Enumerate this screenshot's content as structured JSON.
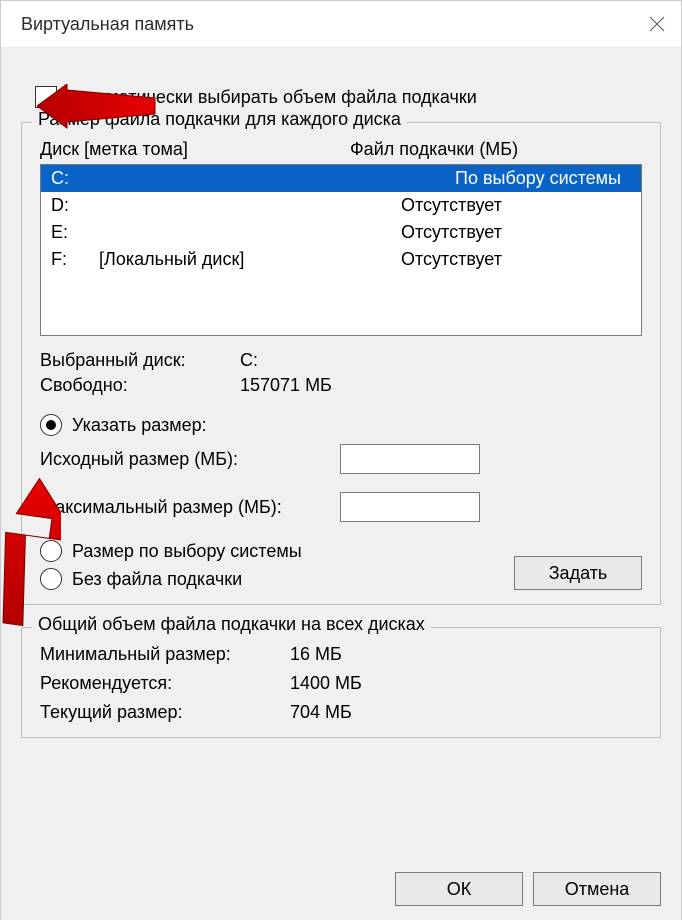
{
  "title": "Виртуальная память",
  "auto_label": "Автоматически выбирать объем файла подкачки",
  "group1": {
    "legend": "Размер файла подкачки для каждого диска",
    "col_drive": "Диск [метка тома]",
    "col_pf": "Файл подкачки (МБ)",
    "rows": [
      {
        "drive": "C:",
        "label": "",
        "status": "По выбору системы",
        "selected": true
      },
      {
        "drive": "D:",
        "label": "",
        "status": "Отсутствует",
        "selected": false
      },
      {
        "drive": "E:",
        "label": "",
        "status": "Отсутствует",
        "selected": false
      },
      {
        "drive": "F:",
        "label": "[Локальный диск]",
        "status": "Отсутствует",
        "selected": false
      }
    ],
    "selected_drive_label": "Выбранный диск:",
    "selected_drive_value": "C:",
    "free_label": "Свободно:",
    "free_value": "157071 МБ",
    "radio_custom": "Указать размер:",
    "initial_label": "Исходный размер (МБ):",
    "initial_value": "",
    "max_label": "Максимальный размер (МБ):",
    "max_value": "",
    "radio_system": "Размер по выбору системы",
    "radio_none": "Без файла подкачки",
    "set_btn": "Задать"
  },
  "group2": {
    "legend": "Общий объем файла подкачки на всех дисках",
    "min_label": "Минимальный размер:",
    "min_value": "16 МБ",
    "rec_label": "Рекомендуется:",
    "rec_value": "1400 МБ",
    "cur_label": "Текущий размер:",
    "cur_value": "704 МБ"
  },
  "ok": "ОК",
  "cancel": "Отмена"
}
